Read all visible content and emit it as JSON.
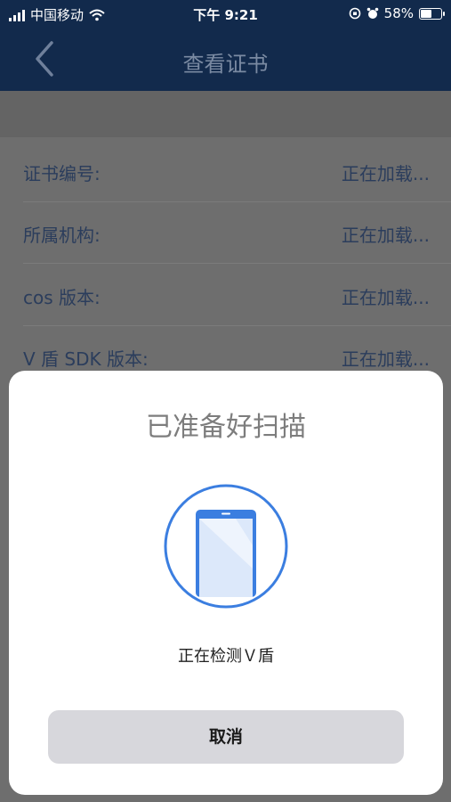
{
  "status_bar": {
    "carrier": "中国移动",
    "time": "下午 9:21",
    "battery_percent": "58%",
    "battery_level": 0.58
  },
  "nav": {
    "title": "查看证书",
    "back_icon": "chevron-left-icon"
  },
  "certificate": {
    "rows": [
      {
        "label": "证书编号:",
        "value": "正在加载..."
      },
      {
        "label": "所属机构:",
        "value": "正在加载..."
      },
      {
        "label": "cos 版本:",
        "value": "正在加载..."
      },
      {
        "label": "V 盾 SDK 版本:",
        "value": "正在加载..."
      }
    ]
  },
  "dialog": {
    "title": "已准备好扫描",
    "icon": "phone-icon",
    "status": "正在检测Ｖ盾",
    "cancel_label": "取消"
  },
  "colors": {
    "nav_background": "#122a4c",
    "accent_blue": "#3b7ee0",
    "dialog_background": "#ffffff",
    "cancel_button": "#d7d7dc"
  }
}
